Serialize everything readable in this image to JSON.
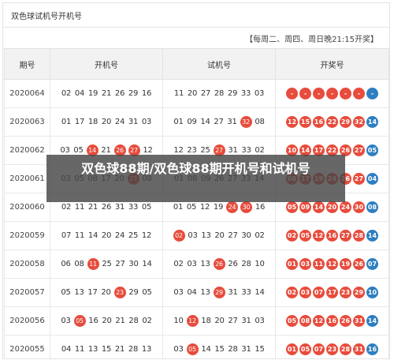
{
  "title": "双色球试机号开机号",
  "draw_note": "【每周二、周四、周日晚21:15开奖】",
  "columns": [
    "期号",
    "开机号",
    "试机号",
    "开奖号"
  ],
  "colors": {
    "red": "#e74c3c",
    "blue": "#2e7fc1"
  },
  "rows": [
    {
      "period": "2020064",
      "open": [
        "02",
        "04",
        "19",
        "21",
        "26",
        "29",
        "16"
      ],
      "open_hl": [],
      "test": [
        "11",
        "20",
        "27",
        "28",
        "29",
        "33",
        "03"
      ],
      "test_hl": [],
      "result_red": [
        "-",
        "-",
        "-",
        "-",
        "-",
        "-"
      ],
      "result_blue": "-"
    },
    {
      "period": "2020063",
      "open": [
        "01",
        "17",
        "18",
        "20",
        "24",
        "31",
        "03"
      ],
      "open_hl": [],
      "test": [
        "01",
        "09",
        "14",
        "27",
        "31",
        "32",
        "08"
      ],
      "test_hl": [
        5
      ],
      "result_red": [
        "12",
        "15",
        "16",
        "22",
        "29",
        "32"
      ],
      "result_blue": "14"
    },
    {
      "period": "2020062",
      "open": [
        "03",
        "05",
        "14",
        "21",
        "26",
        "27",
        "12"
      ],
      "open_hl": [
        2,
        4,
        5
      ],
      "test": [
        "12",
        "23",
        "25",
        "27",
        "31",
        "33",
        "02"
      ],
      "test_hl": [
        3
      ],
      "result_red": [
        "10",
        "14",
        "17",
        "22",
        "26",
        "27"
      ],
      "result_blue": "05"
    },
    {
      "period": "2020061",
      "open": [
        "03",
        "05",
        "08",
        "17",
        "20",
        "27",
        "08"
      ],
      "open_hl": [
        5
      ],
      "test": [
        "01",
        "08",
        "09",
        "26",
        "27",
        "33",
        "14"
      ],
      "test_hl": [],
      "result_red": [
        "08",
        "17",
        "19",
        "24",
        "26",
        "27"
      ],
      "result_blue": "04"
    },
    {
      "period": "2020060",
      "open": [
        "02",
        "11",
        "21",
        "26",
        "31",
        "33",
        "05"
      ],
      "open_hl": [],
      "test": [
        "01",
        "05",
        "12",
        "19",
        "24",
        "30",
        "16"
      ],
      "test_hl": [
        4,
        5
      ],
      "result_red": [
        "05",
        "09",
        "14",
        "20",
        "24",
        "30"
      ],
      "result_blue": "08"
    },
    {
      "period": "2020059",
      "open": [
        "07",
        "11",
        "14",
        "20",
        "24",
        "25",
        "12"
      ],
      "open_hl": [],
      "test": [
        "02",
        "03",
        "13",
        "20",
        "27",
        "30",
        "02"
      ],
      "test_hl": [
        0
      ],
      "result_red": [
        "02",
        "05",
        "12",
        "16",
        "27",
        "28"
      ],
      "result_blue": "14"
    },
    {
      "period": "2020058",
      "open": [
        "06",
        "08",
        "11",
        "25",
        "27",
        "30",
        "14"
      ],
      "open_hl": [
        2
      ],
      "test": [
        "02",
        "03",
        "13",
        "26",
        "26",
        "28",
        "10"
      ],
      "test_hl": [
        3
      ],
      "result_red": [
        "01",
        "03",
        "11",
        "12",
        "19",
        "26"
      ],
      "result_blue": "07"
    },
    {
      "period": "2020057",
      "open": [
        "05",
        "13",
        "17",
        "20",
        "23",
        "29",
        "05"
      ],
      "open_hl": [
        4
      ],
      "test": [
        "03",
        "04",
        "13",
        "29",
        "31",
        "33",
        "14"
      ],
      "test_hl": [
        3
      ],
      "result_red": [
        "02",
        "03",
        "07",
        "17",
        "23",
        "29"
      ],
      "result_blue": "10"
    },
    {
      "period": "2020056",
      "open": [
        "03",
        "05",
        "16",
        "20",
        "21",
        "28",
        "02"
      ],
      "open_hl": [
        1
      ],
      "test": [
        "10",
        "12",
        "18",
        "20",
        "27",
        "31",
        "03"
      ],
      "test_hl": [
        1
      ],
      "result_red": [
        "05",
        "08",
        "12",
        "16",
        "26",
        "31"
      ],
      "result_blue": "14"
    },
    {
      "period": "2020055",
      "open": [
        "04",
        "11",
        "13",
        "15",
        "21",
        "28",
        "13"
      ],
      "open_hl": [],
      "test": [
        "03",
        "05",
        "14",
        "15",
        "28",
        "31",
        "15"
      ],
      "test_hl": [
        1
      ],
      "result_red": [
        "01",
        "05",
        "07",
        "23",
        "28",
        "31"
      ],
      "result_blue": "16"
    }
  ],
  "overlay_caption": "双色球88期/双色球88期开机号和试机号"
}
